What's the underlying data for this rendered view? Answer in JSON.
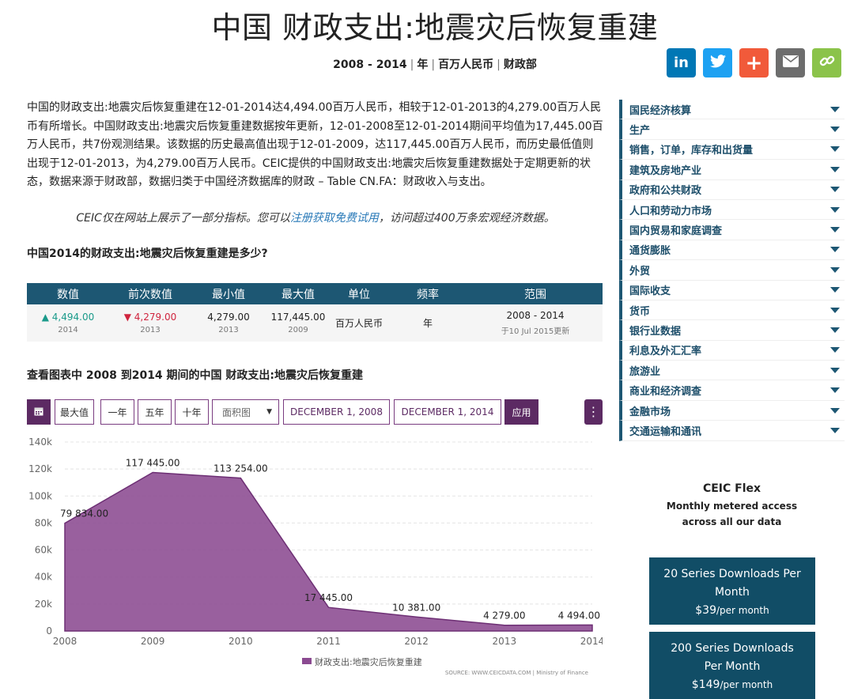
{
  "page": {
    "title": "中国 财政支出:地震灾后恢复重建",
    "subtitle_parts": [
      "2008 - 2014",
      "年",
      "百万人民币",
      "财政部"
    ],
    "description": "中国的财政支出:地震灾后恢复重建在12-01-2014达4,494.00百万人民币，相较于12-01-2013的4,279.00百万人民币有所增长。中国财政支出:地震灾后恢复重建数据按年更新，12-01-2008至12-01-2014期间平均值为17,445.00百万人民币，共7份观测结果。该数据的历史最高值出现于12-01-2009，达117,445.00百万人民币，而历史最低值则出现于12-01-2013，为4,279.00百万人民币。CEIC提供的中国财政支出:地震灾后恢复重建数据处于定期更新的状态，数据来源于财政部，数据归类于中国经济数据库的财政 – Table CN.FA：财政收入与支出。",
    "promo_before": "CEIC仅在网站上展示了一部分指标。您可以",
    "promo_link": "注册获取免费试用",
    "promo_after": "，访问超过400万条宏观经济数据。",
    "question1": "中国2014的财政支出:地震灾后恢复重建是多少?",
    "question2": "查看图表中 2008 到2014 期间的中国 财政支出:地震灾后恢复重建"
  },
  "share": [
    {
      "icon": "linkedin-icon",
      "glyph": "in",
      "color": "#0077b5"
    },
    {
      "icon": "twitter-icon",
      "glyph": "🐦",
      "color": "#1da1f2"
    },
    {
      "icon": "plus-icon",
      "glyph": "+",
      "color": "#f15a3a"
    },
    {
      "icon": "email-icon",
      "glyph": "✉",
      "color": "#6d6d6d"
    },
    {
      "icon": "link-icon",
      "glyph": "🔗",
      "color": "#8bc34a"
    }
  ],
  "stats": {
    "headers": [
      "数值",
      "前次数值",
      "最小值",
      "最大值",
      "单位",
      "频率",
      "范围"
    ],
    "value": "4,494.00",
    "value_year": "2014",
    "prev": "4,279.00",
    "prev_year": "2013",
    "min": "4,279.00",
    "min_year": "2013",
    "max": "117,445.00",
    "max_year": "2009",
    "unit": "百万人民币",
    "freq": "年",
    "range": "2008 - 2014",
    "updated": "于10 Jul 2015更新"
  },
  "toolbar": {
    "calendar_icon": "calendar-icon",
    "btn_max": "最大值",
    "btn_1y": "一年",
    "btn_5y": "五年",
    "btn_10y": "十年",
    "chart_type": "面积图",
    "start_date": "DECEMBER 1, 2008",
    "end_date": "DECEMBER 1, 2014",
    "apply": "应用",
    "menu_icon": "more-vertical-icon"
  },
  "chart_data": {
    "type": "area",
    "x": [
      "2008",
      "2009",
      "2010",
      "2011",
      "2012",
      "2013",
      "2014"
    ],
    "series": [
      {
        "name": "财政支出:地震灾后恢复重建",
        "values": [
          79834.0,
          117445.0,
          113254.0,
          17445.0,
          10381.0,
          4279.0,
          4494.0
        ]
      }
    ],
    "data_labels": [
      "79 834.00",
      "117 445.00",
      "113 254.00",
      "17 445.00",
      "10 381.00",
      "4 279.00",
      "4 494.00"
    ],
    "ylim": [
      0,
      140000
    ],
    "yticks": [
      0,
      20000,
      40000,
      60000,
      80000,
      100000,
      120000,
      140000
    ],
    "ytick_labels": [
      "0",
      "20k",
      "40k",
      "60k",
      "80k",
      "100k",
      "120k",
      "140k"
    ],
    "grid": true,
    "legend": "bottom-center",
    "color": "#8b4a91",
    "source": "SOURCE: WWW.CEICDATA.COM | Ministry of Finance"
  },
  "sidebar": {
    "items": [
      "国民经济核算",
      "生产",
      "销售，订单，库存和出货量",
      "建筑及房地产业",
      "政府和公共财政",
      "人口和劳动力市场",
      "国内贸易和家庭调查",
      "通货膨胀",
      "外贸",
      "国际收支",
      "货币",
      "银行业数据",
      "利息及外汇汇率",
      "旅游业",
      "商业和经济调查",
      "金融市场",
      "交通运输和通讯"
    ]
  },
  "flex": {
    "title": "CEIC Flex",
    "line1": "Monthly metered access",
    "line2": "across all our data",
    "plan1_line1": "20 Series Downloads Per",
    "plan1_line2": "Month",
    "plan1_price": "$39",
    "plan1_per": "/per month",
    "plan2_line1": "200 Series Downloads",
    "plan2_line2": "Per Month",
    "plan2_price": "$149",
    "plan2_per": "/per month"
  }
}
